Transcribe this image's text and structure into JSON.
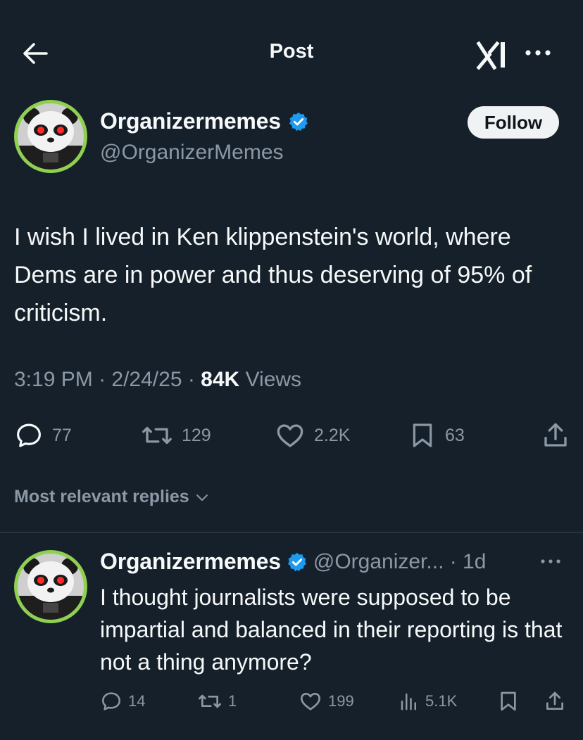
{
  "header": {
    "title": "Post",
    "back_icon": "arrow-left-icon",
    "grok_icon": "grok-icon",
    "more_icon": "ellipsis-icon"
  },
  "post": {
    "author": {
      "name": "Organizermemes",
      "handle": "@OrganizerMemes",
      "verified": true,
      "follow_label": "Follow"
    },
    "text": "I wish I lived in Ken klippenstein's world, where Dems are in power and thus deserving of 95% of criticism.",
    "time": "3:19 PM",
    "date": "2/24/25",
    "views_count": "84K",
    "views_label": "Views",
    "stats": {
      "replies": "77",
      "reposts": "129",
      "likes": "2.2K",
      "bookmarks": "63"
    }
  },
  "replies_filter": {
    "label": "Most relevant replies"
  },
  "reply": {
    "name": "Organizermemes",
    "handle_time": "@Organizer... · 1d",
    "text": "I thought journalists were supposed to be impartial and balanced in their reporting is that not a thing anymore?",
    "stats": {
      "replies": "14",
      "reposts": "1",
      "likes": "199",
      "views": "5.1K"
    }
  },
  "colors": {
    "background": "#15202b",
    "text": "#f7f9f9",
    "muted": "#8b98a5",
    "verified": "#1d9bf0",
    "avatar_ring": "#8fd14f",
    "follow_bg": "#eff3f4"
  }
}
